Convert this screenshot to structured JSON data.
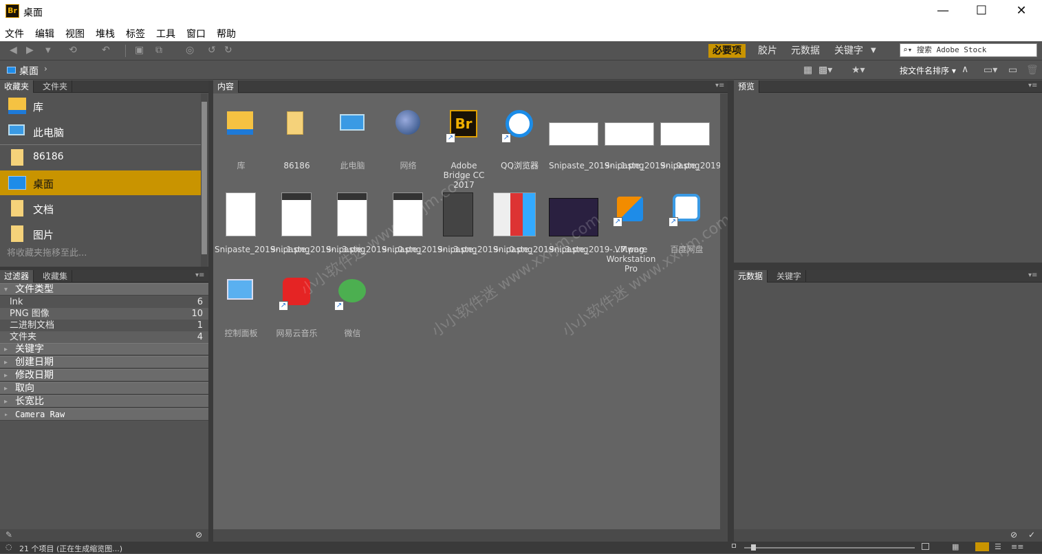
{
  "window": {
    "title": "桌面",
    "app_badge": "Br",
    "minimize": "—",
    "maximize": "☐",
    "close": "✕"
  },
  "menu": [
    "文件",
    "编辑",
    "视图",
    "堆栈",
    "标签",
    "工具",
    "窗口",
    "帮助"
  ],
  "workspaces": [
    "必要项",
    "胶片",
    "元数据",
    "关键字"
  ],
  "search": {
    "placeholder": "搜索 Adobe Stock"
  },
  "path": {
    "current": "桌面"
  },
  "sort": {
    "label": "按文件名排序"
  },
  "left_tabs": [
    "收藏夹",
    "文件夹"
  ],
  "favorites": [
    {
      "label": "库",
      "icon": "library-folder-icon"
    },
    {
      "label": "此电脑",
      "icon": "computer-icon"
    },
    {
      "label": "86186",
      "icon": "user-folder-icon"
    },
    {
      "label": "桌面",
      "icon": "desktop-icon",
      "selected": true
    },
    {
      "label": "文档",
      "icon": "documents-folder-icon"
    },
    {
      "label": "图片",
      "icon": "pictures-folder-icon"
    }
  ],
  "favorites_hint": "将收藏夹拖移至此...",
  "filter_tabs": [
    "过滤器",
    "收藏集"
  ],
  "filter": {
    "file_type_heading": "文件类型",
    "file_types": [
      {
        "label": "lnk",
        "count": "6"
      },
      {
        "label": "PNG 图像",
        "count": "10"
      },
      {
        "label": "二进制文档",
        "count": "1"
      },
      {
        "label": "文件夹",
        "count": "4"
      }
    ],
    "collapsed_headings": [
      "关键字",
      "创建日期",
      "修改日期",
      "取向",
      "长宽比",
      "Camera Raw"
    ]
  },
  "content_tab": "内容",
  "preview_tab": "预览",
  "meta_tabs": [
    "元数据",
    "关键字"
  ],
  "items": [
    {
      "label": "库",
      "kind": "library-folder"
    },
    {
      "label": "86186",
      "kind": "folder"
    },
    {
      "label": "此电脑",
      "kind": "computer"
    },
    {
      "label": "网络",
      "kind": "network"
    },
    {
      "label": "Adobe Bridge CC 2017",
      "kind": "bridge"
    },
    {
      "label": "QQ浏览器",
      "kind": "qqbrowser"
    },
    {
      "label": "Snipaste_2019-...1.png",
      "kind": "screenshot-wide"
    },
    {
      "label": "Snipaste_2019-...9.png",
      "kind": "screenshot-wide"
    },
    {
      "label": "Snipaste_2019-...8.png",
      "kind": "screenshot-wide"
    },
    {
      "label": "Snipaste_2019-...1.png",
      "kind": "screenshot-doc"
    },
    {
      "label": "Snipaste_2019-...3.png",
      "kind": "screenshot-dialog"
    },
    {
      "label": "Snipaste_2019-...0.png",
      "kind": "screenshot-dialog"
    },
    {
      "label": "Snipaste_2019-...3.png",
      "kind": "screenshot-dialog"
    },
    {
      "label": "Snipaste_2019-...0.png",
      "kind": "screenshot-dark"
    },
    {
      "label": "Snipaste_2019-...3.png",
      "kind": "screenshot-start"
    },
    {
      "label": "Snipaste_2019-...7.png",
      "kind": "screenshot-splash"
    },
    {
      "label": "VMware Workstation Pro",
      "kind": "vmware"
    },
    {
      "label": "百度网盘",
      "kind": "baidu"
    },
    {
      "label": "控制面板",
      "kind": "control-panel"
    },
    {
      "label": "网易云音乐",
      "kind": "netease"
    },
    {
      "label": "微信",
      "kind": "wechat"
    }
  ],
  "watermark": [
    "小小软件迷 www.xxrjm.com",
    "小小软件迷 www.xxrjm.com",
    "小小软件迷 www.xxrjm.com"
  ],
  "status": {
    "text": "21 个项目 (正在生成缩览图...)"
  }
}
